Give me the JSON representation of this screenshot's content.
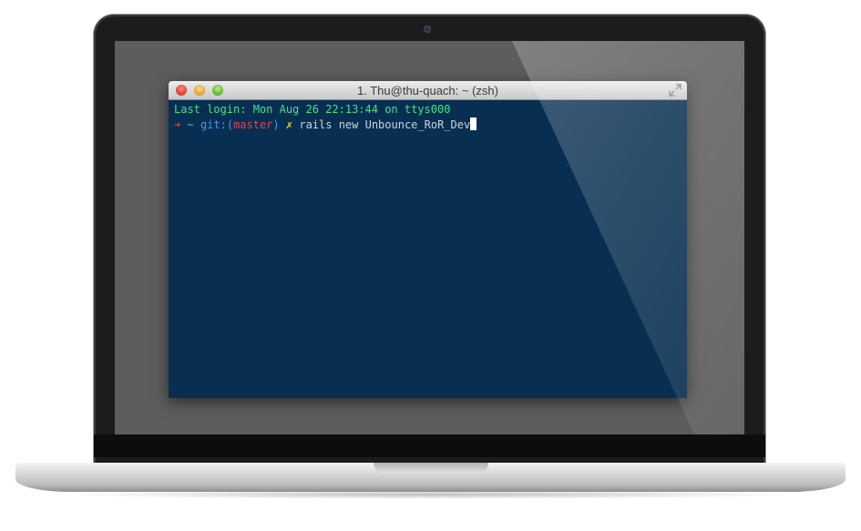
{
  "window": {
    "title": "1. Thu@thu-quach: ~ (zsh)"
  },
  "terminal": {
    "last_login_line": "Last login: Mon Aug 26 22:13:44 on ttys000",
    "prompt": {
      "arrow": "➜",
      "dir": "~",
      "git_prefix": "git:(",
      "branch": "master",
      "git_suffix": ")",
      "dirty_mark": "✗",
      "command": "rails new Unbounce_RoR_Dev"
    }
  },
  "colors": {
    "terminal_bg": "#082f51",
    "login_text": "#47e089",
    "prompt_arrow": "#ee3c3c",
    "git_label": "#3b9ee6",
    "branch": "#e0455a",
    "dirty_mark": "#f3d23b",
    "command": "#c8d4de",
    "screen_bg": "#5d5d5d"
  },
  "icons": {
    "close": "close-dot-icon",
    "minimize": "minimize-dot-icon",
    "maximize": "zoom-dot-icon",
    "fullscreen": "fullscreen-arrows-icon",
    "camera": "webcam-icon"
  }
}
